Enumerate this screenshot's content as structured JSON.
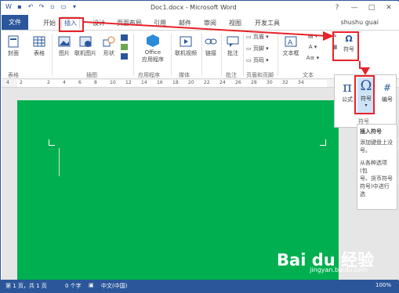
{
  "titlebar": {
    "title": "Doc1.docx - Microsoft Word",
    "help": "?",
    "minimize": "—",
    "maximize": "□",
    "close": "✕"
  },
  "tabs": {
    "file": "文件",
    "home": "开始",
    "insert": "插入",
    "design": "设计",
    "layout": "页面布局",
    "references": "引用",
    "mailings": "邮件",
    "review": "审阅",
    "view": "视图",
    "developer": "开发工具",
    "user": "shushu guai"
  },
  "ribbon": {
    "cover": "封面",
    "table": "表格",
    "pictures": "图片",
    "online_pictures": "联机图片",
    "shapes": "形状",
    "office_line1": "Office",
    "office_line2": "应用程序",
    "online_video": "联机视频",
    "link": "链接",
    "comment": "批注",
    "header": "页眉",
    "footer": "页脚",
    "page_number": "页码",
    "textbox": "文本框",
    "symbol": "符号",
    "groups": {
      "tables": "表格",
      "illustrations": "插图",
      "apps": "应用程序",
      "media": "媒体",
      "comments": "批注",
      "header_footer": "页眉和页脚",
      "text": "文本"
    }
  },
  "ruler": {
    "ticks": [
      "4",
      "2",
      "2",
      "4",
      "6",
      "8",
      "10",
      "12",
      "14",
      "16",
      "18",
      "20",
      "22",
      "24",
      "26",
      "28",
      "30",
      "32",
      "34"
    ]
  },
  "symbol_panel": {
    "equation": "公式",
    "symbol": "符号",
    "numbering": "编号",
    "group_label": "符号"
  },
  "tooltip": {
    "title": "插入符号",
    "line1": "添加键盘上没",
    "line2": "号。",
    "line3": "从各种选项(包",
    "line4": "号、货币符号",
    "line5": "符号)中进行选"
  },
  "status": {
    "page": "第 1 页，共 1 页",
    "words": "0 个字",
    "lang": "中文(中国)",
    "zoom": "100%"
  },
  "watermark": {
    "logo": "Bai du 经验",
    "url": "jingyan.baidu.com"
  },
  "colors": {
    "accent": "#2b579a",
    "page": "#00b050",
    "highlight": "#e8232a"
  }
}
